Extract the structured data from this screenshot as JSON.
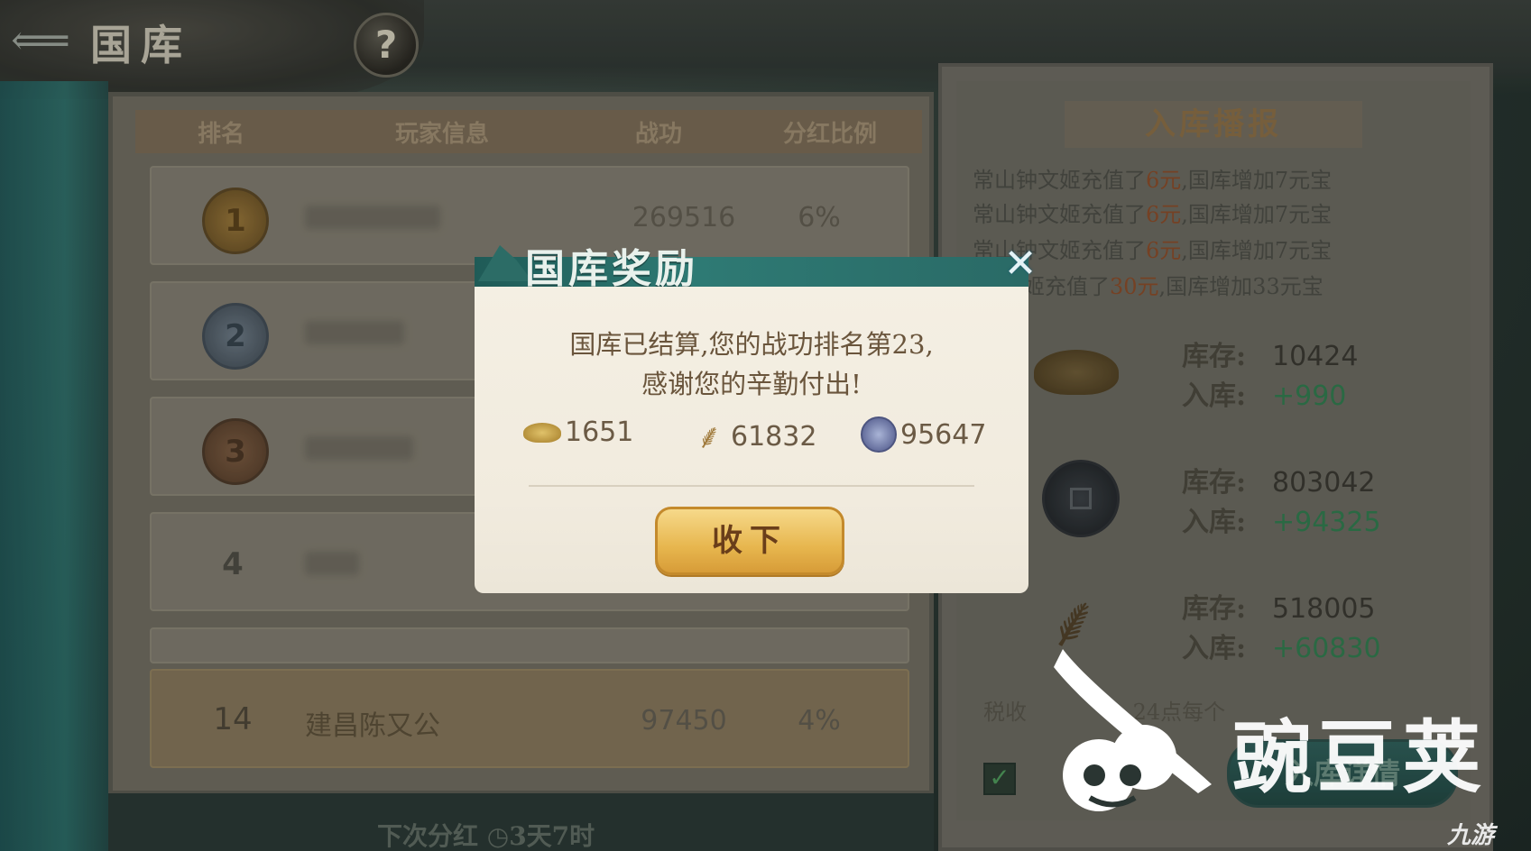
{
  "topbar": {
    "back_icon": "back-arrow-icon",
    "title": "国库",
    "help_label": "?"
  },
  "rank_table": {
    "headers": [
      "排名",
      "玩家信息",
      "战功",
      "分红比例"
    ],
    "rows": [
      {
        "rank": "1",
        "war_merit": "269516",
        "ratio": "6%"
      },
      {
        "rank": "2",
        "war_merit": "",
        "ratio": ""
      },
      {
        "rank": "3",
        "war_merit": "",
        "ratio": ""
      },
      {
        "rank": "4",
        "war_merit": "",
        "ratio": ""
      }
    ],
    "self_row": {
      "rank": "14",
      "name": "建昌陈又公",
      "war_merit": "97450",
      "ratio": "4%"
    },
    "next_dividend_label": "下次分红",
    "next_dividend_time": "3天7时"
  },
  "broadcast": {
    "title": "入库播报",
    "lines": [
      {
        "pre": "常山钟文姬充值了",
        "amt": "6元",
        "post": ",国库增加7元宝"
      },
      {
        "pre": "常山钟文姬充值了",
        "amt": "6元",
        "post": ",国库增加7元宝"
      },
      {
        "pre": "常山钟文姬充值了",
        "amt": "6元",
        "post": ",国库增加7元宝"
      },
      {
        "pre": "文姬充值了",
        "amt": "30元",
        "post": ",国库增加33元宝"
      }
    ]
  },
  "treasury": {
    "stock_label": "库存:",
    "income_label": "入库:",
    "items": [
      {
        "icon": "gold-ingot-icon",
        "stock": "10424",
        "income": "+990"
      },
      {
        "icon": "copper-coin-icon",
        "stock": "803042",
        "income": "+94325"
      },
      {
        "icon": "feather-icon",
        "stock": "518005",
        "income": "+60830"
      }
    ],
    "tax_note": "税收",
    "tax_note_tail": "24点每个",
    "auto_label": "",
    "detail_button": "入库详情"
  },
  "modal": {
    "title": "国库奖励",
    "message_line1": "国库已结算,您的战功排名第23,",
    "message_line2": "感谢您的辛勤付出!",
    "rewards": [
      {
        "icon": "gold-ingot-icon",
        "amount": "1651"
      },
      {
        "icon": "feather-icon",
        "amount": "61832"
      },
      {
        "icon": "silver-coin-icon",
        "amount": "95647"
      }
    ],
    "accept_button": "收下"
  },
  "watermark": {
    "brand": "豌豆荚",
    "corner": "九游"
  }
}
